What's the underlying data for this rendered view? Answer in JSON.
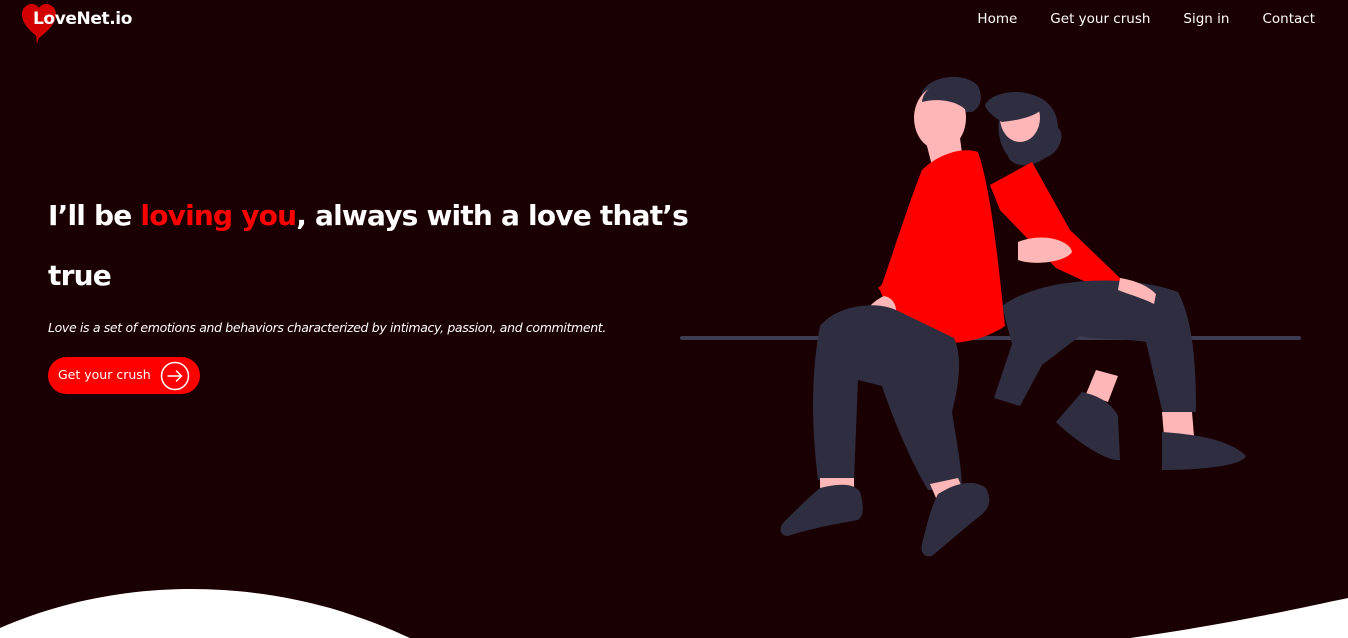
{
  "brand": {
    "name": "LoveNet.io",
    "logo_icon": "heart-icon",
    "logo_color": "#d20000"
  },
  "nav": {
    "items": [
      {
        "label": "Home"
      },
      {
        "label": "Get your crush"
      },
      {
        "label": "Sign in"
      },
      {
        "label": "Contact"
      }
    ]
  },
  "hero": {
    "title_before": "I’ll be ",
    "title_accent": "loving you",
    "title_after": ", always with a love that’s true",
    "description": "Love is a set of emotions and behaviors characterized by intimacy, passion, and commitment.",
    "cta_label": "Get your crush",
    "cta_icon": "arrow-right-circle-icon"
  },
  "illustration": {
    "subject": "couple-sitting-on-rail",
    "icon": "couple-illustration-icon"
  },
  "colors": {
    "background": "#1a0003",
    "accent": "#ff0000",
    "text": "#ffffff",
    "clothing_dark": "#2f2e41",
    "skin": "#ffb6b6",
    "wave": "#ffffff"
  }
}
